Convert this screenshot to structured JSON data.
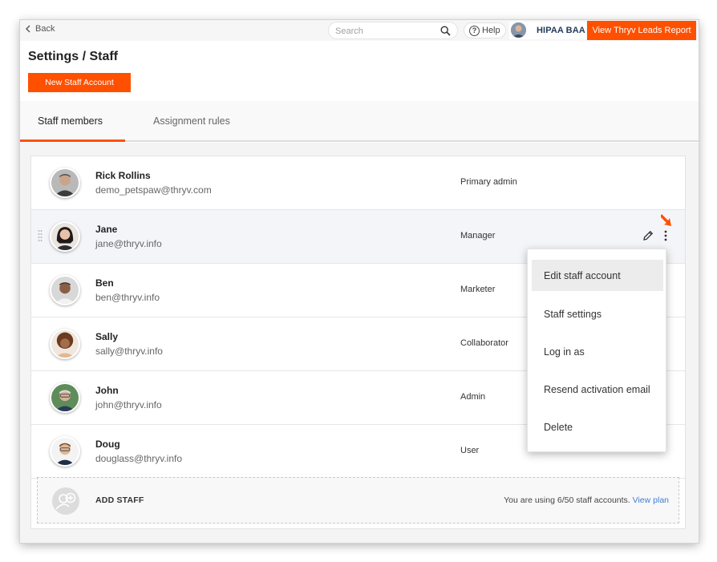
{
  "topbar": {
    "back_label": "Back",
    "search_placeholder": "Search",
    "help_label": "Help",
    "account_name": "HIPAA BAA",
    "report_button": "View Thryv Leads Report"
  },
  "page": {
    "title": "Settings / Staff",
    "new_staff_button": "New Staff Account"
  },
  "tabs": [
    {
      "label": "Staff members",
      "active": true
    },
    {
      "label": "Assignment rules",
      "active": false
    }
  ],
  "staff": [
    {
      "name": "Rick Rollins",
      "email": "demo_petspaw@thryv.com",
      "role": "Primary admin"
    },
    {
      "name": "Jane",
      "email": "jane@thryv.info",
      "role": "Manager"
    },
    {
      "name": "Ben",
      "email": "ben@thryv.info",
      "role": "Marketer"
    },
    {
      "name": "Sally",
      "email": "sally@thryv.info",
      "role": "Collaborator"
    },
    {
      "name": "John",
      "email": "john@thryv.info",
      "role": "Admin"
    },
    {
      "name": "Doug",
      "email": "douglass@thryv.info",
      "role": "User"
    }
  ],
  "add_staff": {
    "label": "ADD STAFF",
    "usage_text": "You are using 6/50 staff accounts.",
    "view_plan_link": "View plan"
  },
  "row_menu": {
    "items": [
      "Edit staff account",
      "Staff settings",
      "Log in as",
      "Resend activation email",
      "Delete"
    ],
    "highlighted_index": 0
  },
  "colors": {
    "accent": "#ff5000",
    "link": "#3d7fd4"
  }
}
